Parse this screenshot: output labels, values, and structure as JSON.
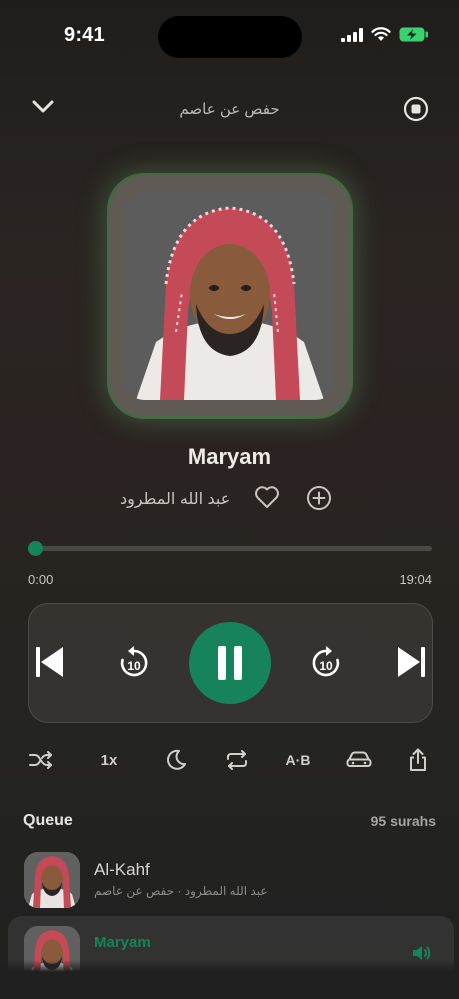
{
  "status": {
    "time": "9:41"
  },
  "header": {
    "title": "حفص عن عاصم",
    "collapse_icon": "chevron-down-icon",
    "stop_icon": "stop-circle-icon"
  },
  "now_playing": {
    "title": "Maryam",
    "reciter": "عبد الله المطرود",
    "elapsed": "0:00",
    "duration": "19:04",
    "progress": 0.0
  },
  "controls": {
    "skip_interval": "10"
  },
  "toolbar": {
    "speed_label": "1x",
    "ab_label": "A·B"
  },
  "queue": {
    "label": "Queue",
    "count": "95 surahs",
    "items": [
      {
        "title": "Al-Kahf",
        "subtitle": "عبد الله المطرود · حفص عن عاصم"
      },
      {
        "title": "Maryam"
      }
    ]
  },
  "colors": {
    "accent": "#17835a"
  }
}
